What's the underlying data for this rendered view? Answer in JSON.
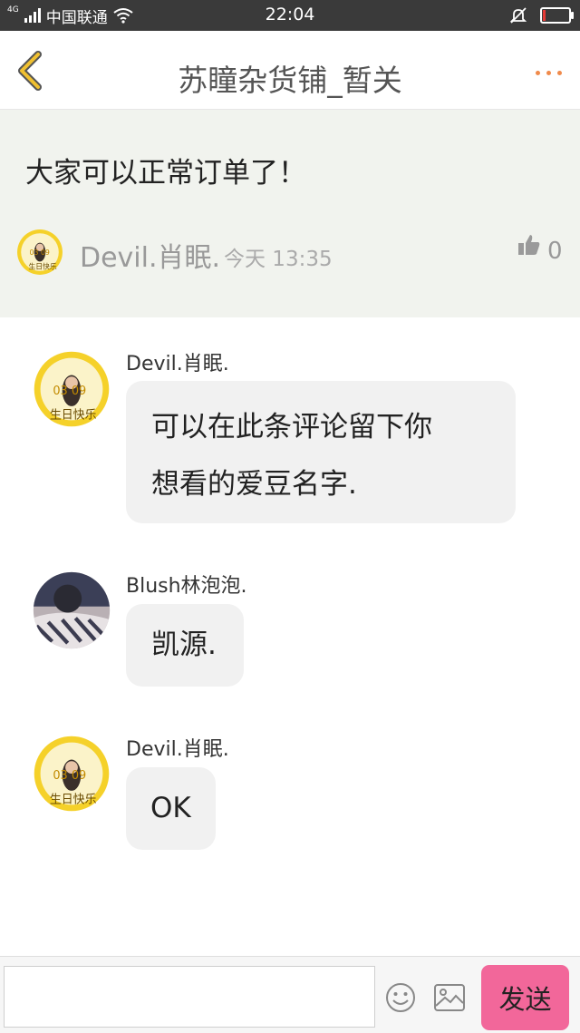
{
  "status_bar": {
    "network": "4G",
    "carrier": "中国联通",
    "time": "22:04",
    "battery_level": 0.12,
    "battery_color": "#e53935"
  },
  "header": {
    "title": "苏瞳杂货铺_暂关",
    "back_icon": "chevron-left-icon",
    "accent_color": "#f0c030",
    "more_icon": "more-dots-icon"
  },
  "post": {
    "text": "大家可以正常订单了！",
    "author": "Devil.肖眠.",
    "time": "今天 13:35",
    "like_count": "0",
    "avatar_text_top": "03 09",
    "avatar_text_bottom": "生日快乐"
  },
  "comments": [
    {
      "author": "Devil.肖眠.",
      "lines": [
        "可以在此条评论留下你",
        "想看的爱豆名字."
      ],
      "avatar": "birthday-badge"
    },
    {
      "author": "Blush林泡泡.",
      "lines": [
        "凯源."
      ],
      "avatar": "photo"
    },
    {
      "author": "Devil.肖眠.",
      "lines": [
        "OK"
      ],
      "avatar": "birthday-badge"
    }
  ],
  "input_bar": {
    "placeholder": "",
    "send_label": "发送",
    "send_color": "#f2679a"
  }
}
